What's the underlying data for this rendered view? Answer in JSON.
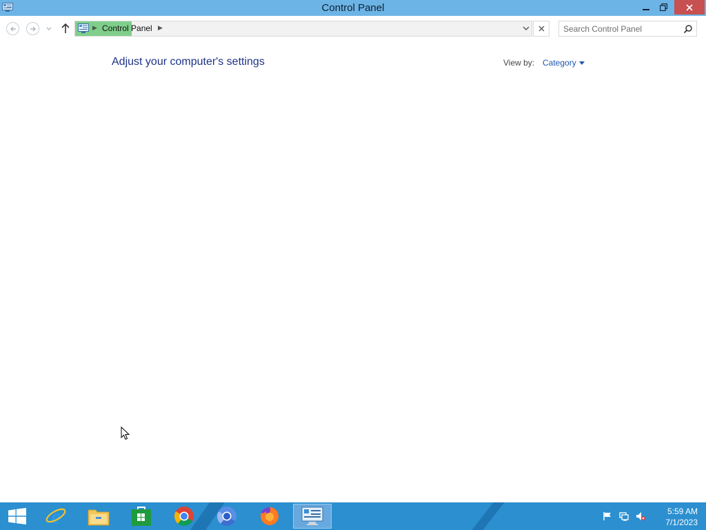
{
  "window": {
    "title": "Control Panel",
    "controls": {
      "minimize": "minimize",
      "maximize": "restore",
      "close": "close"
    }
  },
  "address_bar": {
    "crumbs": [
      {
        "label": "Control Panel"
      }
    ]
  },
  "search": {
    "placeholder": "Search Control Panel"
  },
  "content": {
    "heading": "Adjust your computer's settings",
    "view_by_label": "View by:",
    "view_by_value": "Category"
  },
  "taskbar": {
    "apps": [
      {
        "name": "internet-explorer",
        "icon": "ie-icon"
      },
      {
        "name": "file-explorer",
        "icon": "folder-icon"
      },
      {
        "name": "store",
        "icon": "store-icon"
      },
      {
        "name": "chrome",
        "icon": "chrome-icon"
      },
      {
        "name": "chromium",
        "icon": "chromium-icon"
      },
      {
        "name": "firefox",
        "icon": "firefox-icon"
      },
      {
        "name": "control-panel",
        "icon": "control-panel-icon",
        "active": true
      }
    ],
    "tray": {
      "icons": [
        "flag-icon",
        "network-icon",
        "volume-muted-icon"
      ]
    },
    "clock": {
      "time": "5:59 AM",
      "date": "7/1/2023"
    }
  },
  "colors": {
    "titlebar": "#6cb4e6",
    "taskbar": "#2b8fd0",
    "heading": "#1e3287",
    "link": "#1e56b0",
    "close_button": "#c75050",
    "breadcrumb_highlight": "#7fcf8a"
  }
}
